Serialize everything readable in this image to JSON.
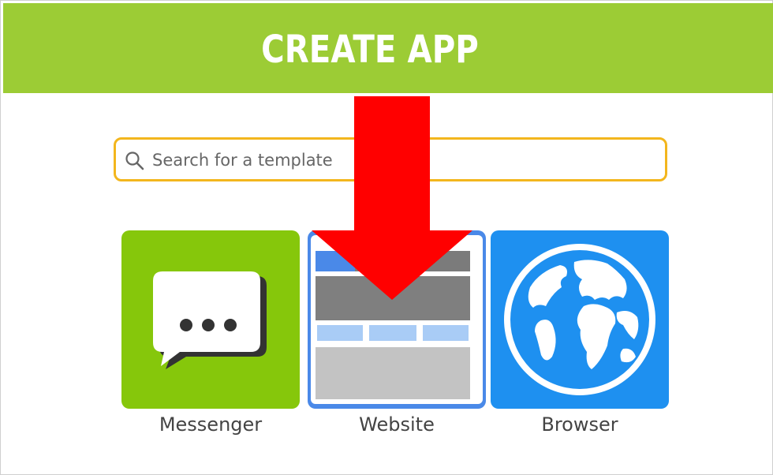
{
  "header": {
    "title": "CREATE APP",
    "background_color": "#9ccc35"
  },
  "search": {
    "placeholder": "Search for a template",
    "value": "",
    "icon": "search-icon",
    "border_color": "#f3b61d"
  },
  "templates": [
    {
      "label": "Messenger",
      "icon": "chat-bubble-icon",
      "color": "#86c70b"
    },
    {
      "label": "Website",
      "icon": "webpage-layout-icon",
      "color": "#4a89e8"
    },
    {
      "label": "Browser",
      "icon": "globe-icon",
      "color": "#1e90f0"
    }
  ],
  "overlay": {
    "icon": "down-arrow-icon",
    "color": "#ff0000"
  }
}
